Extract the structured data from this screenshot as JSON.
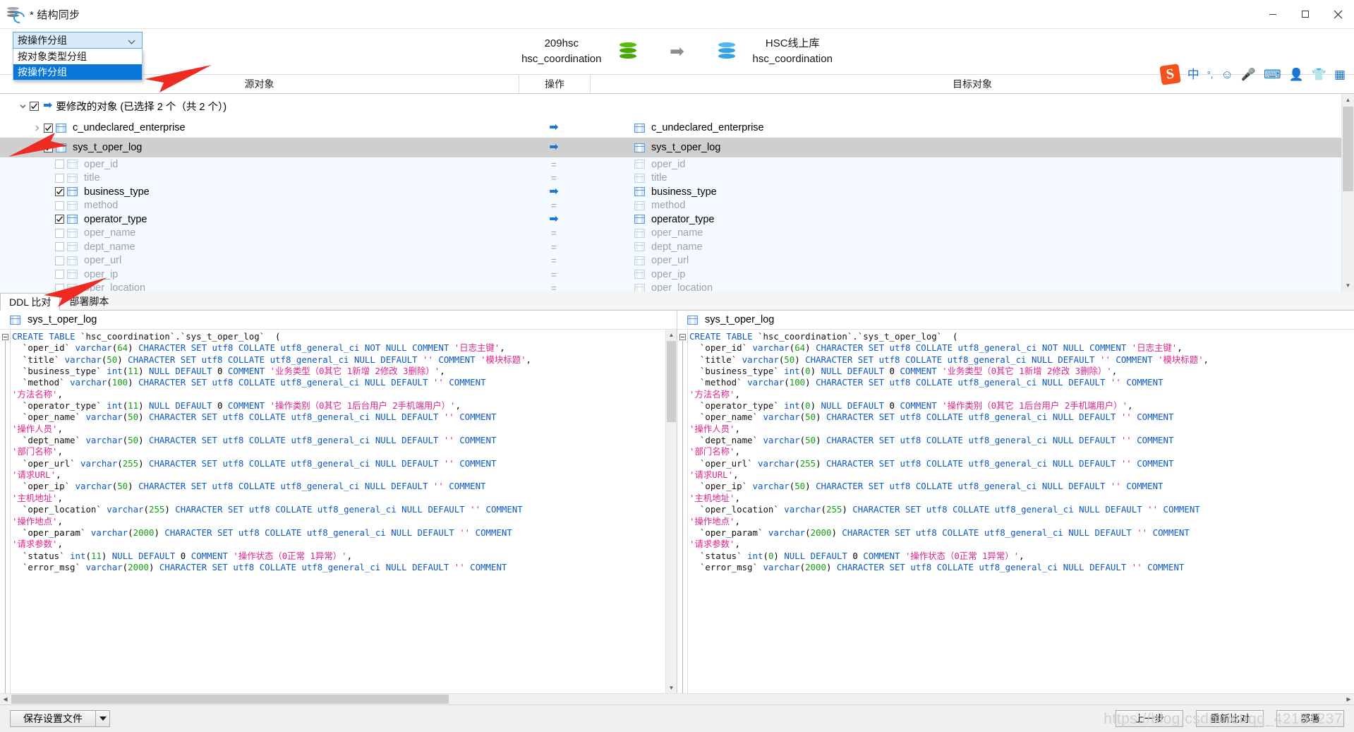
{
  "window": {
    "title": "* 结构同步",
    "icon": "db-sync-icon",
    "minimize": "minimize",
    "maximize": "maximize",
    "close": "close"
  },
  "group_combo": {
    "selected": "按操作分组",
    "options": [
      "按对象类型分组",
      "按操作分组"
    ],
    "highlighted_option": "按操作分组"
  },
  "db_pair": {
    "source": {
      "connection": "209hsc",
      "schema": "hsc_coordination",
      "icon_color": "#46a800"
    },
    "arrow": "➡",
    "target": {
      "connection": "HSC线上库",
      "schema": "hsc_coordination",
      "icon_color": "#33a2e6"
    }
  },
  "ime_bar": {
    "logo": "S",
    "items": [
      "中",
      "°,",
      "☺",
      "🎤",
      "⌨",
      "👤",
      "👕",
      "▦"
    ]
  },
  "columns": {
    "source": "源对象",
    "operation": "操作",
    "target": "目标对象"
  },
  "tree": {
    "group": {
      "label": "要修改的对象 (已选择 2 个（共 2 个）)",
      "expanded": true,
      "checked": true,
      "op": "➡"
    },
    "tables": [
      {
        "name": "c_undeclared_enterprise",
        "target": "c_undeclared_enterprise",
        "expanded": false,
        "checked": true,
        "op": "➡",
        "selected": false,
        "columns": []
      },
      {
        "name": "sys_t_oper_log",
        "target": "sys_t_oper_log",
        "expanded": true,
        "checked": true,
        "op": "➡",
        "selected": true,
        "columns": [
          {
            "name": "oper_id",
            "target": "oper_id",
            "checked": false,
            "op": "="
          },
          {
            "name": "title",
            "target": "title",
            "checked": false,
            "op": "="
          },
          {
            "name": "business_type",
            "target": "business_type",
            "checked": true,
            "op": "➡"
          },
          {
            "name": "method",
            "target": "method",
            "checked": false,
            "op": "="
          },
          {
            "name": "operator_type",
            "target": "operator_type",
            "checked": true,
            "op": "➡"
          },
          {
            "name": "oper_name",
            "target": "oper_name",
            "checked": false,
            "op": "="
          },
          {
            "name": "dept_name",
            "target": "dept_name",
            "checked": false,
            "op": "="
          },
          {
            "name": "oper_url",
            "target": "oper_url",
            "checked": false,
            "op": "="
          },
          {
            "name": "oper_ip",
            "target": "oper_ip",
            "checked": false,
            "op": "="
          },
          {
            "name": "oper_location",
            "target": "oper_location",
            "checked": false,
            "op": "="
          }
        ]
      }
    ]
  },
  "bottom_tabs": {
    "items": [
      "DDL 比对",
      "部署脚本"
    ],
    "active": "DDL 比对"
  },
  "ddl": {
    "left": {
      "title": "sys_t_oper_log",
      "lines": [
        "CREATE TABLE `hsc_coordination`.`sys_t_oper_log`  (",
        "  `oper_id` varchar(64) CHARACTER SET utf8 COLLATE utf8_general_ci NOT NULL COMMENT '日志主键',",
        "  `title` varchar(50) CHARACTER SET utf8 COLLATE utf8_general_ci NULL DEFAULT '' COMMENT '模块标题',",
        "  `business_type` int(11) NULL DEFAULT 0 COMMENT '业务类型（0其它 1新增 2修改 3删除）',",
        "  `method` varchar(100) CHARACTER SET utf8 COLLATE utf8_general_ci NULL DEFAULT '' COMMENT",
        "'方法名称',",
        "  `operator_type` int(11) NULL DEFAULT 0 COMMENT '操作类别（0其它 1后台用户 2手机端用户）',",
        "  `oper_name` varchar(50) CHARACTER SET utf8 COLLATE utf8_general_ci NULL DEFAULT '' COMMENT",
        "'操作人员',",
        "  `dept_name` varchar(50) CHARACTER SET utf8 COLLATE utf8_general_ci NULL DEFAULT '' COMMENT",
        "'部门名称',",
        "  `oper_url` varchar(255) CHARACTER SET utf8 COLLATE utf8_general_ci NULL DEFAULT '' COMMENT",
        "'请求URL',",
        "  `oper_ip` varchar(50) CHARACTER SET utf8 COLLATE utf8_general_ci NULL DEFAULT '' COMMENT",
        "'主机地址',",
        "  `oper_location` varchar(255) CHARACTER SET utf8 COLLATE utf8_general_ci NULL DEFAULT '' COMMENT",
        "'操作地点',",
        "  `oper_param` varchar(2000) CHARACTER SET utf8 COLLATE utf8_general_ci NULL DEFAULT '' COMMENT",
        "'请求参数',",
        "  `status` int(11) NULL DEFAULT 0 COMMENT '操作状态（0正常 1异常）',",
        "  `error_msg` varchar(2000) CHARACTER SET utf8 COLLATE utf8_general_ci NULL DEFAULT '' COMMENT"
      ]
    },
    "right": {
      "title": "sys_t_oper_log",
      "lines": [
        "CREATE TABLE `hsc_coordination`.`sys_t_oper_log`  (",
        "  `oper_id` varchar(64) CHARACTER SET utf8 COLLATE utf8_general_ci NOT NULL COMMENT '日志主键',",
        "  `title` varchar(50) CHARACTER SET utf8 COLLATE utf8_general_ci NULL DEFAULT '' COMMENT '模块标题',",
        "  `business_type` int(0) NULL DEFAULT 0 COMMENT '业务类型（0其它 1新增 2修改 3删除）',",
        "  `method` varchar(100) CHARACTER SET utf8 COLLATE utf8_general_ci NULL DEFAULT '' COMMENT",
        "'方法名称',",
        "  `operator_type` int(0) NULL DEFAULT 0 COMMENT '操作类别（0其它 1后台用户 2手机端用户）',",
        "  `oper_name` varchar(50) CHARACTER SET utf8 COLLATE utf8_general_ci NULL DEFAULT '' COMMENT",
        "'操作人员',",
        "  `dept_name` varchar(50) CHARACTER SET utf8 COLLATE utf8_general_ci NULL DEFAULT '' COMMENT",
        "'部门名称',",
        "  `oper_url` varchar(255) CHARACTER SET utf8 COLLATE utf8_general_ci NULL DEFAULT '' COMMENT",
        "'请求URL',",
        "  `oper_ip` varchar(50) CHARACTER SET utf8 COLLATE utf8_general_ci NULL DEFAULT '' COMMENT",
        "'主机地址',",
        "  `oper_location` varchar(255) CHARACTER SET utf8 COLLATE utf8_general_ci NULL DEFAULT '' COMMENT",
        "'操作地点',",
        "  `oper_param` varchar(2000) CHARACTER SET utf8 COLLATE utf8_general_ci NULL DEFAULT '' COMMENT",
        "'请求参数',",
        "  `status` int(0) NULL DEFAULT 0 COMMENT '操作状态（0正常 1异常）',",
        "  `error_msg` varchar(2000) CHARACTER SET utf8 COLLATE utf8_general_ci NULL DEFAULT '' COMMENT"
      ]
    }
  },
  "footer": {
    "save_settings": "保存设置文件",
    "prev": "上一步",
    "recompare": "重新比对",
    "deploy": "部署"
  },
  "watermark": "https://blog.csdn.net/qq_42151237"
}
